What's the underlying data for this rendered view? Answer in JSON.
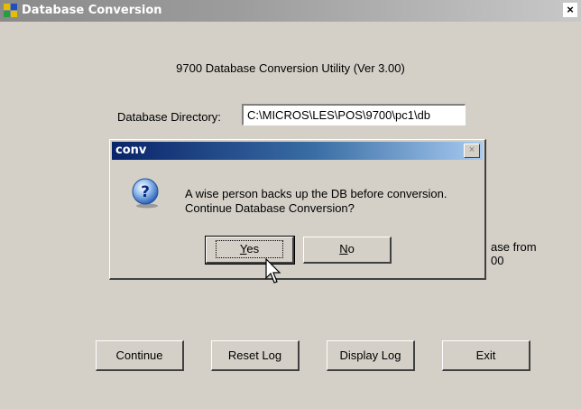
{
  "window": {
    "title": "Database Conversion",
    "close_label": "×"
  },
  "main": {
    "utility_title": "9700 Database Conversion Utility (Ver 3.00)",
    "db_dir_label": "Database Directory:",
    "db_dir_value": "C:\\MICROS\\LES\\POS\\9700\\pc1\\db",
    "partial_line1": "ase from",
    "partial_line2": "00"
  },
  "buttons": {
    "continue": "Continue",
    "reset_log": "Reset Log",
    "display_log": "Display Log",
    "exit": "Exit"
  },
  "dialog": {
    "title": "conv",
    "close_label": "×",
    "message_line1": "A wise person backs up the DB before conversion.",
    "message_line2": "Continue Database Conversion?",
    "yes_first": "Y",
    "yes_rest": "es",
    "no_first": "N",
    "no_rest": "o",
    "icon": "question-icon"
  }
}
